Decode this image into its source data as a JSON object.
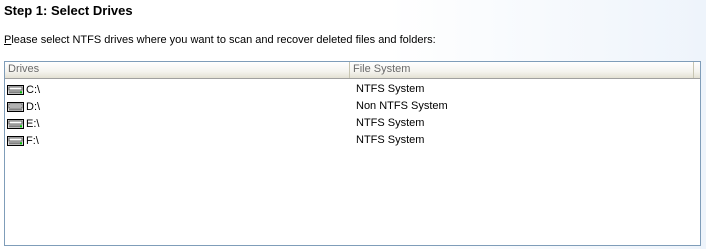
{
  "step_title": "Step 1: Select Drives",
  "instruction": {
    "accel_char": "P",
    "rest": "lease select NTFS drives where you want to scan and recover deleted files and folders:"
  },
  "list": {
    "columns": {
      "drives": "Drives",
      "file_system": "File System"
    },
    "rows": [
      {
        "drive": "C:\\",
        "file_system": "NTFS System",
        "icon": "hard-drive-icon"
      },
      {
        "drive": "D:\\",
        "file_system": "Non NTFS System",
        "icon": "cd-drive-icon"
      },
      {
        "drive": "E:\\",
        "file_system": "NTFS System",
        "icon": "hard-drive-icon"
      },
      {
        "drive": "F:\\",
        "file_system": "NTFS System",
        "icon": "hard-drive-icon"
      }
    ]
  }
}
